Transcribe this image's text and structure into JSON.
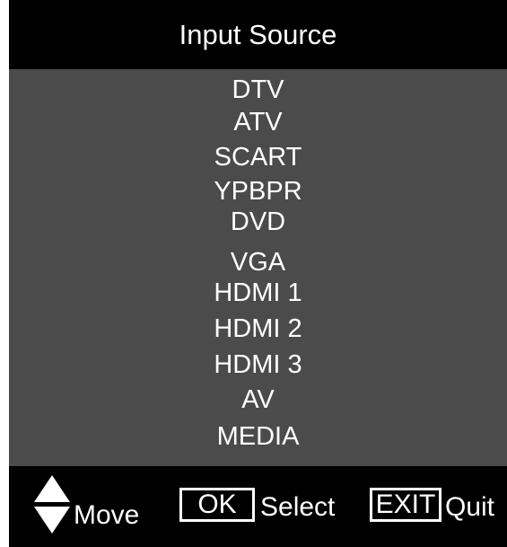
{
  "header": {
    "title": "Input Source"
  },
  "sources": [
    {
      "label": "DTV"
    },
    {
      "label": "ATV"
    },
    {
      "label": "SCART"
    },
    {
      "label": "YPBPR"
    },
    {
      "label": "DVD"
    },
    {
      "label": "VGA"
    },
    {
      "label": "HDMI 1"
    },
    {
      "label": "HDMI 2"
    },
    {
      "label": "HDMI 3"
    },
    {
      "label": "AV"
    },
    {
      "label": "MEDIA"
    }
  ],
  "footer": {
    "move_label": "Move",
    "ok_key": "OK",
    "select_label": "Select",
    "exit_key": "EXIT",
    "quit_label": "Quit"
  },
  "colors": {
    "header_bg": "#000000",
    "list_bg": "#4b4b4b",
    "text": "#ffffff"
  },
  "icons": {
    "up": "triangle-up-icon",
    "down": "triangle-down-icon"
  }
}
